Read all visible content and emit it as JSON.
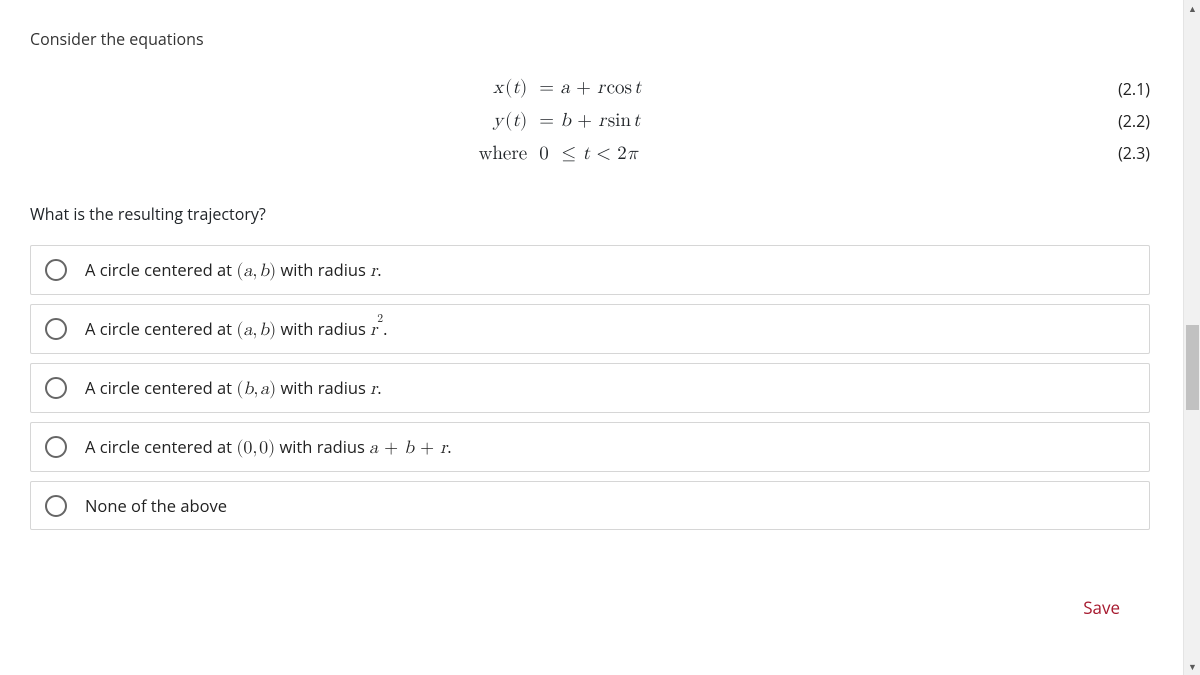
{
  "prompt": "Consider the equations",
  "equations": {
    "rows": [
      {
        "lhs_html": "<span class='mi'>x</span>&#8202;<span class='paren'>(</span><span class='mi'>t</span><span class='paren'>)</span>",
        "rhs_html": "<span class='mn'>=</span> <span class='mi'>a</span> <span class='mn'>+</span> <span class='mi'>r</span>&#8202;<span class='mn'>cos</span>&#8202;<span class='mi'>t</span>"
      },
      {
        "lhs_html": "<span class='mi'>y</span>&#8202;<span class='paren'>(</span><span class='mi'>t</span><span class='paren'>)</span>",
        "rhs_html": "<span class='mn'>=</span> <span class='mi'>b</span> <span class='mn'>+</span> <span class='mi'>r</span>&#8202;<span class='mn'>sin</span>&#8202;<span class='mi'>t</span>"
      },
      {
        "lhs_html": "<span class='mn'>where</span>",
        "rhs_html": "<span class='mn'>0</span> &nbsp;<span class='mn'>&le;</span> <span class='mi'>t</span> <span class='mn'>&lt;</span> <span class='mn'>2</span><span class='mi'>&pi;</span>"
      }
    ],
    "labels": [
      "(2.1)",
      "(2.2)",
      "(2.3)"
    ]
  },
  "question": "What is the resulting trajectory?",
  "options": [
    {
      "html": "A circle centered at <span class='math'><span class='paren'>(</span><span class='mi'>a</span><span class='mn'>,</span>&#8202;<span class='mi'>b</span><span class='paren'>)</span></span> with radius <span class='math'><span class='mi'>r</span></span>."
    },
    {
      "html": "A circle centered at <span class='math'><span class='paren'>(</span><span class='mi'>a</span><span class='mn'>,</span>&#8202;<span class='mi'>b</span><span class='paren'>)</span></span> with radius <span class='math'><span class='mi'>r</span><sup><span class='mn'>2</span></sup></span>."
    },
    {
      "html": "A circle centered at <span class='math'><span class='paren'>(</span><span class='mi'>b</span><span class='mn'>,</span>&#8202;<span class='mi'>a</span><span class='paren'>)</span></span> with radius <span class='math'><span class='mi'>r</span></span>."
    },
    {
      "html": "A circle centered at <span class='math'><span class='paren'>(</span><span class='mn'>0</span><span class='mn'>,</span>&#8202;<span class='mn'>0</span><span class='paren'>)</span></span> with radius <span class='math'><span class='mi'>a</span> <span class='mn'>+</span> <span class='mi'>b</span> <span class='mn'>+</span> <span class='mi'>r</span></span>."
    },
    {
      "html": "None of the above"
    }
  ],
  "save_label": "Save"
}
